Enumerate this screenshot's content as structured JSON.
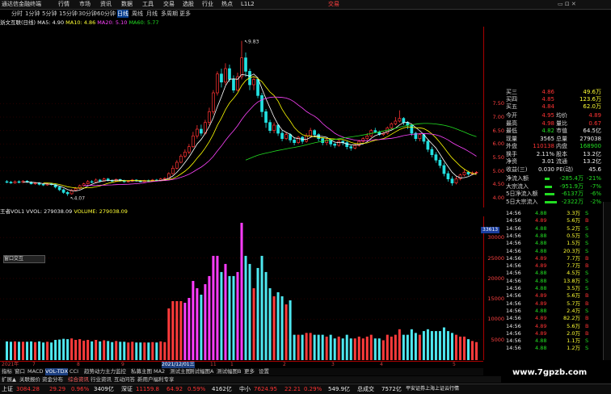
{
  "app": {
    "logo": "通达信金融终端",
    "menu": [
      "行情",
      "市场",
      "资讯",
      "数据",
      "工具",
      "交易",
      "选股",
      "行业",
      "热点",
      "L1L2"
    ],
    "trade": "交易",
    "window_controls": "▭ ⊡ ✕"
  },
  "periods": [
    "分时",
    "1分钟",
    "5分钟",
    "15分钟",
    "30分钟",
    "60分钟",
    "日线",
    "周线",
    "月线",
    "多周期",
    "更多"
  ],
  "ma_line": {
    "title": "浙文互联(日线)",
    "ma5": "MA5: 4.90",
    "ma10": "MA10: 4.86",
    "ma20": "MA20: 5.10",
    "ma60": "MA60: 5.77"
  },
  "vol_line": {
    "title": "王者VOL1",
    "vvol": "VVOL: 279038.09",
    "volume": "VOLUME: 279038.09"
  },
  "chart_data": {
    "type": "candlestick",
    "title": "浙文互联(日线)",
    "ylim": [
      4.0,
      10.0
    ],
    "high_label": "9.83",
    "low_label": "4.07",
    "price_ticks": [
      "7.50",
      "7.00",
      "6.50",
      "6.00",
      "5.50",
      "5.00",
      "4.50",
      "4.00"
    ],
    "vol_ticks": [
      "33613",
      "30000",
      "25000",
      "20000",
      "15000",
      "10000",
      "5000"
    ],
    "candles": [
      [
        4.6,
        4.58,
        4.66,
        4.54
      ],
      [
        4.58,
        4.55,
        4.63,
        4.52
      ],
      [
        4.55,
        4.6,
        4.64,
        4.52
      ],
      [
        4.6,
        4.57,
        4.65,
        4.54
      ],
      [
        4.57,
        4.62,
        4.66,
        4.55
      ],
      [
        4.62,
        4.58,
        4.66,
        4.55
      ],
      [
        4.58,
        4.52,
        4.61,
        4.49
      ],
      [
        4.52,
        4.55,
        4.58,
        4.48
      ],
      [
        4.55,
        4.5,
        4.58,
        4.46
      ],
      [
        4.5,
        4.48,
        4.53,
        4.44
      ],
      [
        4.48,
        4.52,
        4.56,
        4.45
      ],
      [
        4.52,
        4.49,
        4.55,
        4.46
      ],
      [
        4.49,
        4.4,
        4.51,
        4.35
      ],
      [
        4.4,
        4.3,
        4.42,
        4.25
      ],
      [
        4.3,
        4.2,
        4.34,
        4.15
      ],
      [
        4.2,
        4.15,
        4.25,
        4.07
      ],
      [
        4.15,
        4.28,
        4.32,
        4.12
      ],
      [
        4.28,
        4.35,
        4.4,
        4.24
      ],
      [
        4.35,
        4.45,
        4.49,
        4.31
      ],
      [
        4.45,
        4.52,
        4.56,
        4.42
      ],
      [
        4.52,
        4.6,
        4.66,
        4.5
      ],
      [
        4.6,
        4.58,
        4.66,
        4.54
      ],
      [
        4.58,
        4.66,
        4.72,
        4.56
      ],
      [
        4.66,
        4.62,
        4.7,
        4.58
      ],
      [
        4.62,
        4.7,
        4.75,
        4.6
      ],
      [
        4.7,
        4.65,
        4.74,
        4.61
      ],
      [
        4.65,
        4.62,
        4.68,
        4.58
      ],
      [
        4.62,
        4.68,
        4.72,
        4.59
      ],
      [
        4.68,
        4.64,
        4.71,
        4.6
      ],
      [
        4.64,
        4.6,
        4.67,
        4.56
      ],
      [
        4.6,
        4.62,
        4.66,
        4.57
      ],
      [
        4.62,
        4.66,
        4.7,
        4.59
      ],
      [
        4.66,
        4.63,
        4.69,
        4.6
      ],
      [
        4.63,
        4.6,
        4.66,
        4.57
      ],
      [
        4.6,
        4.64,
        4.67,
        4.58
      ],
      [
        4.64,
        4.62,
        4.68,
        4.59
      ],
      [
        4.62,
        4.66,
        4.7,
        4.6
      ],
      [
        4.66,
        4.64,
        4.7,
        4.61
      ],
      [
        4.64,
        4.7,
        4.74,
        4.62
      ],
      [
        4.7,
        4.72,
        4.76,
        4.66
      ],
      [
        4.72,
        4.9,
        4.95,
        4.7
      ],
      [
        4.9,
        5.1,
        5.2,
        4.86
      ],
      [
        5.1,
        5.32,
        5.4,
        5.06
      ],
      [
        5.32,
        5.55,
        5.62,
        5.28
      ],
      [
        5.55,
        5.7,
        5.8,
        5.48
      ],
      [
        5.7,
        5.9,
        6.0,
        5.62
      ],
      [
        5.9,
        6.3,
        6.45,
        5.86
      ],
      [
        6.3,
        6.55,
        6.7,
        6.2
      ],
      [
        6.55,
        6.4,
        6.72,
        6.3
      ],
      [
        6.4,
        6.8,
        6.9,
        6.35
      ],
      [
        6.8,
        7.2,
        7.35,
        6.7
      ],
      [
        7.2,
        7.9,
        8.0,
        7.1
      ],
      [
        7.9,
        8.6,
        8.7,
        7.8
      ],
      [
        8.6,
        8.3,
        8.8,
        8.1
      ],
      [
        8.3,
        8.8,
        9.0,
        8.2
      ],
      [
        8.8,
        8.4,
        8.95,
        8.3
      ],
      [
        8.4,
        8.0,
        8.55,
        7.9
      ],
      [
        8.0,
        8.5,
        8.65,
        7.95
      ],
      [
        8.5,
        9.2,
        9.83,
        8.4
      ],
      [
        9.2,
        8.7,
        9.4,
        8.5
      ],
      [
        8.7,
        8.2,
        8.8,
        8.0
      ],
      [
        8.2,
        8.4,
        8.5,
        8.0
      ],
      [
        8.4,
        7.8,
        8.45,
        7.7
      ],
      [
        7.8,
        7.2,
        7.9,
        7.0
      ],
      [
        7.2,
        6.8,
        7.3,
        6.6
      ],
      [
        6.8,
        6.5,
        6.9,
        6.4
      ],
      [
        6.5,
        6.7,
        6.8,
        6.4
      ],
      [
        6.7,
        6.4,
        6.75,
        6.3
      ],
      [
        6.4,
        6.2,
        6.5,
        6.1
      ],
      [
        6.2,
        6.35,
        6.45,
        6.15
      ],
      [
        6.35,
        6.15,
        6.4,
        6.05
      ],
      [
        6.15,
        6.05,
        6.25,
        5.95
      ],
      [
        6.05,
        6.25,
        6.3,
        6.0
      ],
      [
        6.25,
        6.1,
        6.3,
        6.0
      ],
      [
        6.1,
        6.3,
        6.4,
        6.05
      ],
      [
        6.3,
        6.5,
        6.6,
        6.25
      ],
      [
        6.5,
        6.35,
        6.55,
        6.25
      ],
      [
        6.35,
        6.2,
        6.4,
        6.1
      ],
      [
        6.2,
        6.05,
        6.25,
        5.95
      ],
      [
        6.05,
        6.15,
        6.2,
        5.95
      ],
      [
        6.15,
        6.0,
        6.2,
        5.9
      ],
      [
        6.0,
        5.95,
        6.05,
        5.85
      ],
      [
        5.95,
        6.1,
        6.15,
        5.9
      ],
      [
        6.1,
        6.05,
        6.15,
        5.95
      ],
      [
        6.05,
        5.9,
        6.1,
        5.8
      ],
      [
        5.9,
        5.85,
        5.95,
        5.75
      ],
      [
        5.85,
        5.95,
        6.0,
        5.8
      ],
      [
        5.95,
        6.1,
        6.15,
        5.9
      ],
      [
        6.1,
        6.2,
        6.25,
        6.05
      ],
      [
        6.2,
        6.3,
        6.4,
        6.15
      ],
      [
        6.3,
        6.5,
        6.55,
        6.25
      ],
      [
        6.5,
        6.45,
        6.6,
        6.4
      ],
      [
        6.45,
        6.35,
        6.5,
        6.3
      ],
      [
        6.35,
        6.4,
        6.45,
        6.3
      ],
      [
        6.4,
        6.6,
        6.65,
        6.35
      ],
      [
        6.6,
        6.75,
        6.8,
        6.55
      ],
      [
        6.75,
        6.85,
        7.0,
        6.7
      ],
      [
        6.85,
        6.95,
        7.25,
        6.8
      ],
      [
        6.95,
        6.8,
        7.0,
        6.7
      ],
      [
        6.8,
        6.7,
        6.85,
        6.55
      ],
      [
        6.7,
        6.4,
        6.75,
        6.3
      ],
      [
        6.4,
        6.2,
        6.45,
        6.1
      ],
      [
        6.2,
        6.35,
        6.4,
        6.1
      ],
      [
        6.35,
        6.1,
        6.4,
        6.0
      ],
      [
        6.1,
        5.8,
        6.15,
        5.7
      ],
      [
        5.8,
        5.6,
        5.9,
        5.5
      ],
      [
        5.6,
        5.4,
        5.7,
        5.3
      ],
      [
        5.4,
        5.2,
        5.5,
        5.1
      ],
      [
        5.2,
        4.9,
        5.3,
        4.8
      ],
      [
        4.9,
        4.7,
        5.0,
        4.6
      ],
      [
        4.7,
        4.55,
        4.8,
        4.45
      ],
      [
        4.55,
        4.7,
        4.8,
        4.5
      ],
      [
        4.7,
        4.85,
        4.9,
        4.65
      ],
      [
        4.85,
        4.95,
        5.05,
        4.8
      ],
      [
        4.95,
        4.88,
        5.0,
        4.82
      ],
      [
        4.88,
        4.93,
        4.98,
        4.85
      ],
      [
        4.93,
        4.95,
        4.99,
        4.89
      ]
    ]
  },
  "dates": [
    "2021年",
    "7",
    "8",
    "9",
    "10",
    "11",
    "2021/12/01三",
    "1",
    "2",
    "3",
    "4",
    "5"
  ],
  "indicators": [
    "指标",
    "窗口",
    "MACD",
    "VOL-TDX",
    "CCI",
    "趋势动力",
    "主力监控",
    "私募主图",
    "MA2",
    "测试主图",
    "测试幅图A",
    "测试幅图B",
    "更多",
    "设置"
  ],
  "bottom_tabs": [
    "扩展▲",
    "关联报价",
    "资金分布",
    "综合资讯",
    "行业资讯",
    "互动问答",
    "新用户福利专享"
  ],
  "status": {
    "sh_label": "上证",
    "sh_value": "3084.28",
    "sh_change": "29.29",
    "sh_pct": "0.96%",
    "sh_amount": "3409亿",
    "sz_label": "深证",
    "sz_value": "11159.8",
    "sz_change": "64.92",
    "sz_pct": "0.59%",
    "sz_amount": "4162亿",
    "zx_label": "中小",
    "zx_value": "7624.95",
    "zx_change": "22.21",
    "zx_pct": "0.29%",
    "zx_amount": "549.9亿",
    "zs_label": "总成交",
    "zs_amount": "7572亿",
    "broker": "平安证券上海上证云行情"
  },
  "right_panel": {
    "quote_rows": [
      {
        "label": "买三",
        "val": "4.86",
        "vol": "49.6万"
      },
      {
        "label": "买四",
        "val": "4.85",
        "vol": "123.6万"
      },
      {
        "label": "买五",
        "val": "4.84",
        "vol": "62.0万"
      }
    ],
    "stats": [
      {
        "label": "今开",
        "val": "4.95",
        "label2": "均价",
        "val2": "4.89"
      },
      {
        "label": "最高",
        "val": "4.98",
        "label2": "量比",
        "val2": "0.67"
      },
      {
        "label": "最低",
        "val": "4.82",
        "label2": "市值",
        "val2": "64.5亿"
      },
      {
        "label": "现量",
        "val": "3565",
        "label2": "总量",
        "val2": "279038"
      },
      {
        "label": "外盘",
        "val": "110138",
        "label2": "内盘",
        "val2": "168900"
      },
      {
        "label": "换手",
        "val": "2.11%",
        "label2": "股本",
        "val2": "13.2亿"
      },
      {
        "label": "净资",
        "val": "3.01",
        "label2": "流通",
        "val2": "13.2亿"
      },
      {
        "label": "收益(三)",
        "val": "0.030",
        "label2": "PE(动)",
        "val2": "45.6"
      }
    ],
    "flows": [
      {
        "label": "净流入额",
        "val": "-285.4万",
        "pct": "-21%"
      },
      {
        "label": "大宗流入",
        "val": "-951.9万",
        "pct": "-7%"
      },
      {
        "label": "5日净流入额",
        "val": "-6137万",
        "pct": "-6%"
      },
      {
        "label": "5日大宗流入",
        "val": "-2322万",
        "pct": "-2%"
      }
    ],
    "ticks": [
      {
        "t": "14:56",
        "p": "4.88",
        "v": "3.3万",
        "s": "S"
      },
      {
        "t": "14:56",
        "p": "4.89",
        "v": "5.6万",
        "s": "B"
      },
      {
        "t": "14:56",
        "p": "4.88",
        "v": "5.2万",
        "s": "S"
      },
      {
        "t": "14:56",
        "p": "4.88",
        "v": "0.5万",
        "s": "S"
      },
      {
        "t": "14:56",
        "p": "4.88",
        "v": "1.5万",
        "s": "S"
      },
      {
        "t": "14:56",
        "p": "4.88",
        "v": "20.3万",
        "s": "S"
      },
      {
        "t": "14:56",
        "p": "4.89",
        "v": "7.7万",
        "s": "B"
      },
      {
        "t": "14:56",
        "p": "4.89",
        "v": "7.7万",
        "s": "B"
      },
      {
        "t": "14:56",
        "p": "4.88",
        "v": "4.5万",
        "s": "S"
      },
      {
        "t": "14:56",
        "p": "4.88",
        "v": "13.8万",
        "s": "S"
      },
      {
        "t": "14:56",
        "p": "4.88",
        "v": "3.5万",
        "s": "S"
      },
      {
        "t": "14:56",
        "p": "4.89",
        "v": "5.6万",
        "s": "B"
      },
      {
        "t": "14:56",
        "p": "4.89",
        "v": "5.7万",
        "s": "B"
      },
      {
        "t": "14:56",
        "p": "4.88",
        "v": "2.4万",
        "s": "S"
      },
      {
        "t": "14:56",
        "p": "4.89",
        "v": "82.2万",
        "s": "B"
      },
      {
        "t": "14:56",
        "p": "4.89",
        "v": "5.6万",
        "s": "B"
      },
      {
        "t": "14:56",
        "p": "4.89",
        "v": "2.0万",
        "s": "B"
      },
      {
        "t": "14:56",
        "p": "4.88",
        "v": "1.1万",
        "s": "S"
      },
      {
        "t": "14:56",
        "p": "4.88",
        "v": "1.2万",
        "s": "S"
      }
    ]
  },
  "watermark": "www.7gpzb.com",
  "vol_tag": "33613",
  "small_win": "窗口交互",
  "colors": {
    "up": "#ff3333",
    "down": "#22e0e0",
    "ma5": "#ffffff",
    "ma10": "#ffff00",
    "ma20": "#ff44ff",
    "ma60": "#22dd22",
    "vol_up": "#ff3b3b",
    "vol_down": "#4ee8f0"
  }
}
